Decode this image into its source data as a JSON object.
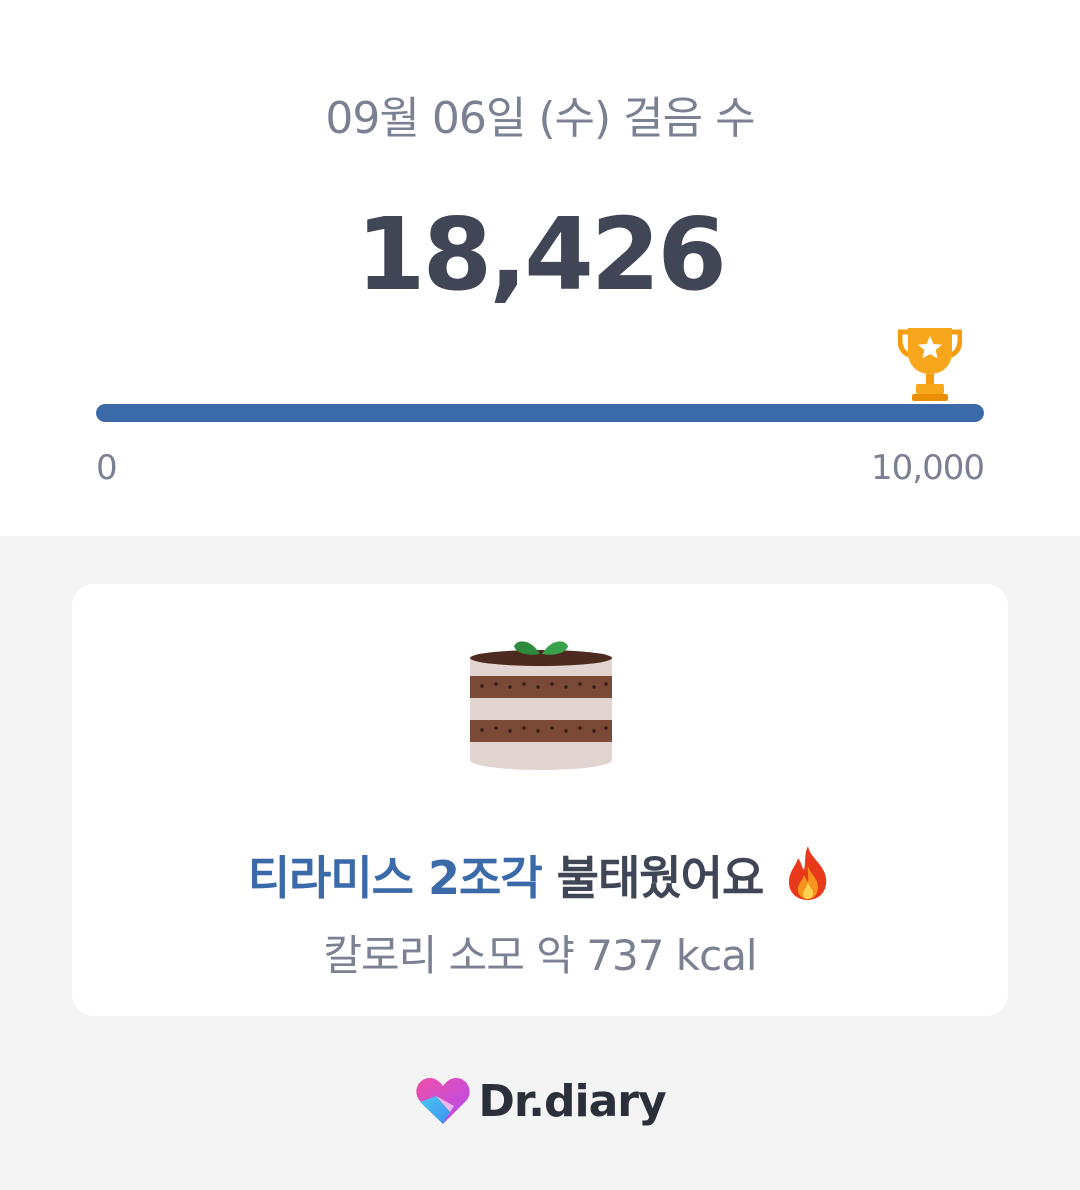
{
  "header": {
    "date_title": "09월 06일 (수) 걸음 수",
    "step_count": "18,426"
  },
  "progress": {
    "min_label": "0",
    "max_label": "10,000",
    "value": 18426,
    "goal": 10000,
    "fill_fraction": 1.0,
    "color": "#3a6aa8",
    "goal_icon": "trophy-icon"
  },
  "calorie_card": {
    "food_icon": "tiramisu-cake-icon",
    "food_highlight": "티라미스 2조각",
    "burn_text": "불태웠어요",
    "burn_icon": "fire-icon",
    "calorie_text": "칼로리 소모 약 737 kcal",
    "accent_color": "#3a6aa8"
  },
  "brand": {
    "name": "Dr.diary",
    "logo_icon": "heart-logo-icon"
  }
}
